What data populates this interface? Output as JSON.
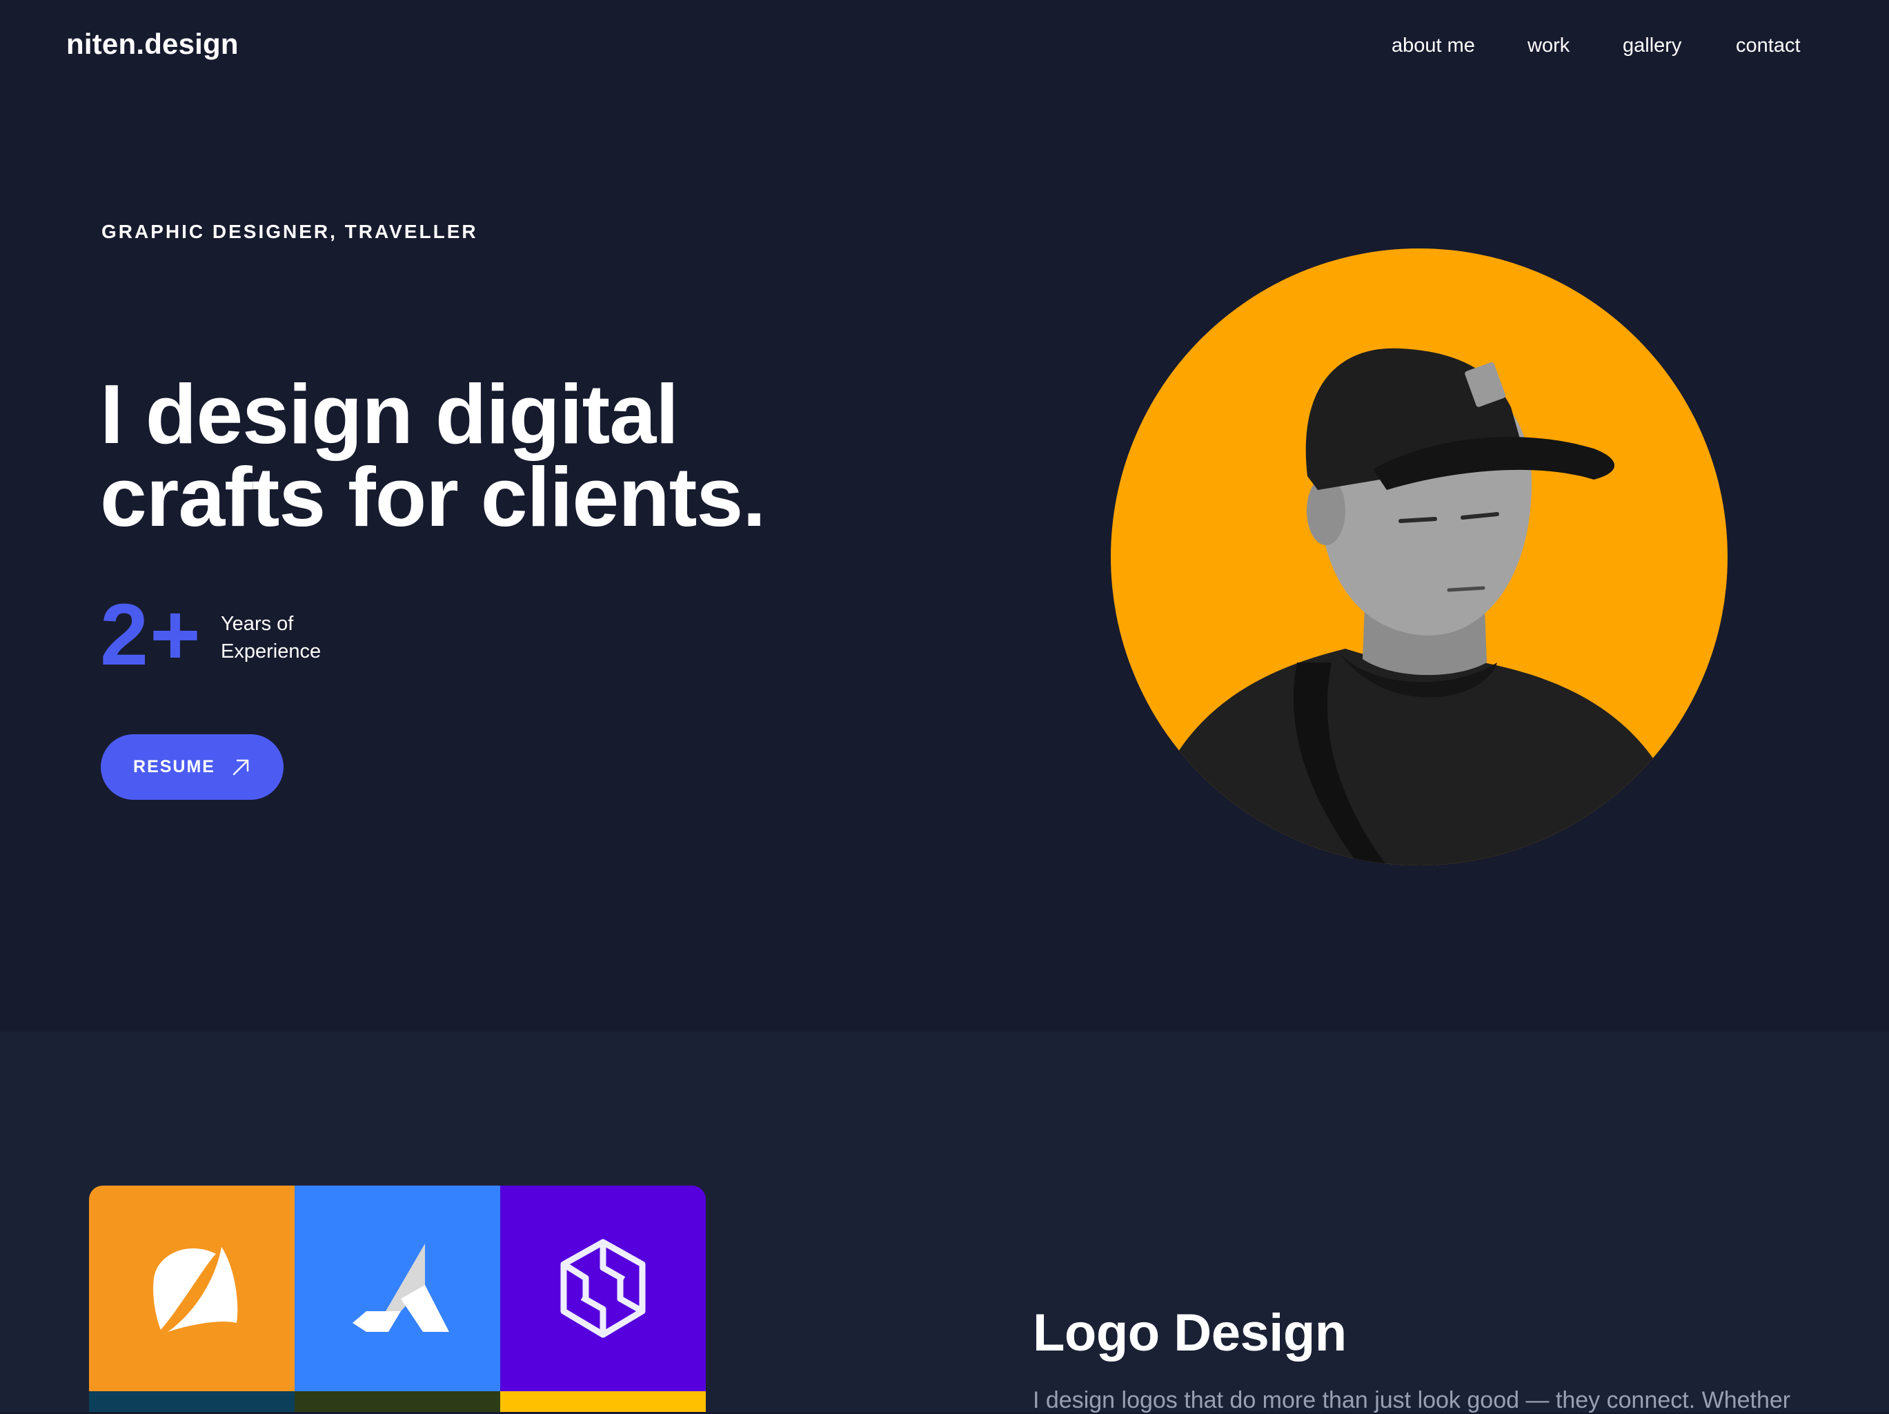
{
  "site": {
    "logo": "niten.design"
  },
  "nav": {
    "items": [
      "about me",
      "work",
      "gallery",
      "contact"
    ]
  },
  "hero": {
    "eyebrow": "GRAPHIC DESIGNER, TRAVELLER",
    "headline_line1": "I design digital",
    "headline_line2": "crafts for clients.",
    "stat_value": "2+",
    "stat_label_line1": "Years of",
    "stat_label_line2": "Experience",
    "resume_label": "RESUME",
    "portrait_bg_color": "#ffa500"
  },
  "work": {
    "title": "Logo Design",
    "text": "I design logos that do more than just look good — they connect. Whether",
    "tiles": [
      {
        "name": "leaf-sail-logo",
        "color": "#f5961f"
      },
      {
        "name": "k-arrow-logo",
        "color": "#3582ff"
      },
      {
        "name": "hexagon-chain-logo",
        "color": "#5500dd"
      },
      {
        "name": "teal-tile",
        "color": "#0c3f5a"
      },
      {
        "name": "olive-tile",
        "color": "#2d3c16"
      },
      {
        "name": "yellow-tile",
        "color": "#ffc000"
      }
    ]
  },
  "colors": {
    "background": "#171b2e",
    "section_background": "#1b2135",
    "accent": "#4c5cf2",
    "portrait_bg": "#ffa500"
  }
}
